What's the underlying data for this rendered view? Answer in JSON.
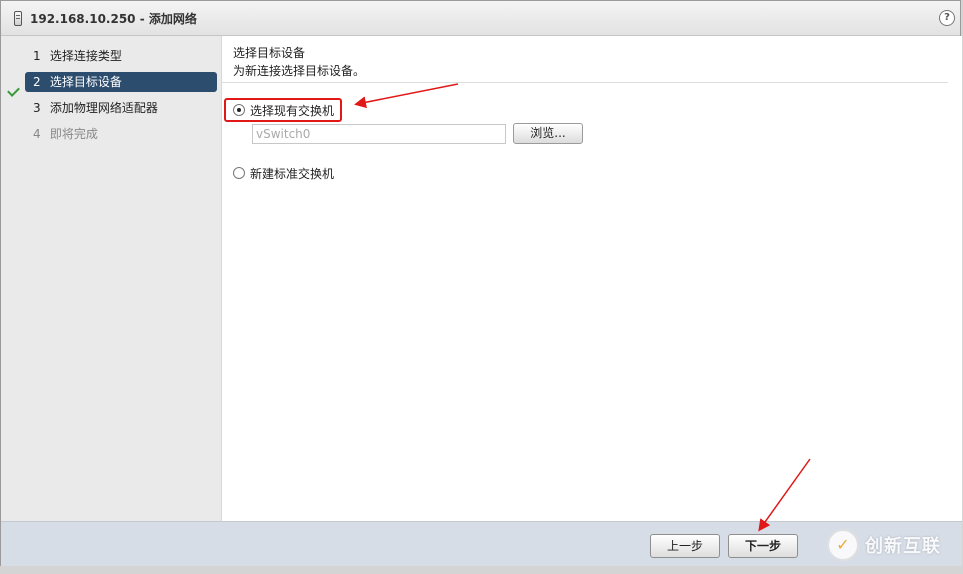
{
  "dialog": {
    "title": "192.168.10.250 - 添加网络",
    "help_icon": "?"
  },
  "steps": [
    {
      "num": "1",
      "label": "选择连接类型",
      "state": "completed"
    },
    {
      "num": "2",
      "label": "选择目标设备",
      "state": "active"
    },
    {
      "num": "3",
      "label": "添加物理网络适配器",
      "state": "pending"
    },
    {
      "num": "4",
      "label": "即将完成",
      "state": "disabled"
    }
  ],
  "content": {
    "title": "选择目标设备",
    "description": "为新连接选择目标设备。",
    "option_existing": "选择现有交换机",
    "switch_value": "vSwitch0",
    "browse_label": "浏览...",
    "option_new": "新建标准交换机"
  },
  "footer": {
    "back_label": "上一步",
    "next_label": "下一步",
    "watermark_text": "创新互联"
  },
  "colors": {
    "active_step": "#2c4d6e",
    "annotation": "#e01818",
    "check": "#3a9a3a"
  }
}
